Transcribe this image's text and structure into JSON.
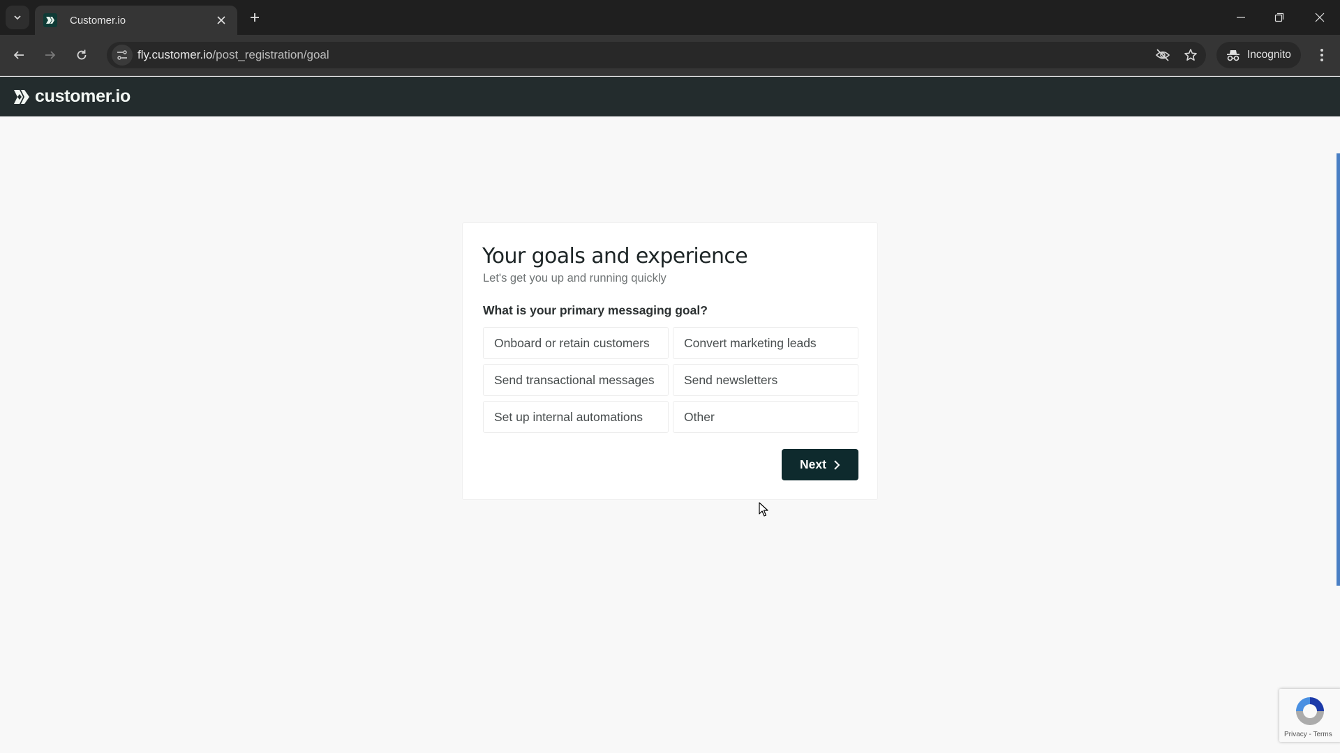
{
  "browser": {
    "tab": {
      "title": "Customer.io",
      "favicon": "customerio-favicon"
    },
    "address_bar": {
      "url_host": "fly.customer.io",
      "url_path": "/post_registration/goal"
    },
    "incognito_label": "Incognito",
    "icons": {
      "tab_search": "chevron-down-icon",
      "close_tab": "close-icon",
      "new_tab": "plus-icon",
      "back": "arrow-left-icon",
      "forward": "arrow-right-icon",
      "reload": "reload-icon",
      "site_info": "tune-icon",
      "tracking": "eye-off-icon",
      "bookmark": "star-icon",
      "incognito": "incognito-icon",
      "menu": "kebab-menu-icon",
      "minimize": "minimize-icon",
      "restore": "restore-icon",
      "close_window": "close-icon"
    }
  },
  "app": {
    "logo_text": "customer.io",
    "brand_color": "#232c2d",
    "accent_color": "#0e2a2d"
  },
  "form": {
    "title": "Your goals and experience",
    "subtitle": "Let's get you up and running quickly",
    "question": "What is your primary messaging goal?",
    "options": [
      {
        "label": "Onboard or retain customers"
      },
      {
        "label": "Convert marketing leads"
      },
      {
        "label": "Send transactional messages"
      },
      {
        "label": "Send newsletters"
      },
      {
        "label": "Set up internal automations"
      },
      {
        "label": "Other"
      }
    ],
    "next_label": "Next"
  },
  "recaptcha": {
    "links": "Privacy - Terms"
  }
}
